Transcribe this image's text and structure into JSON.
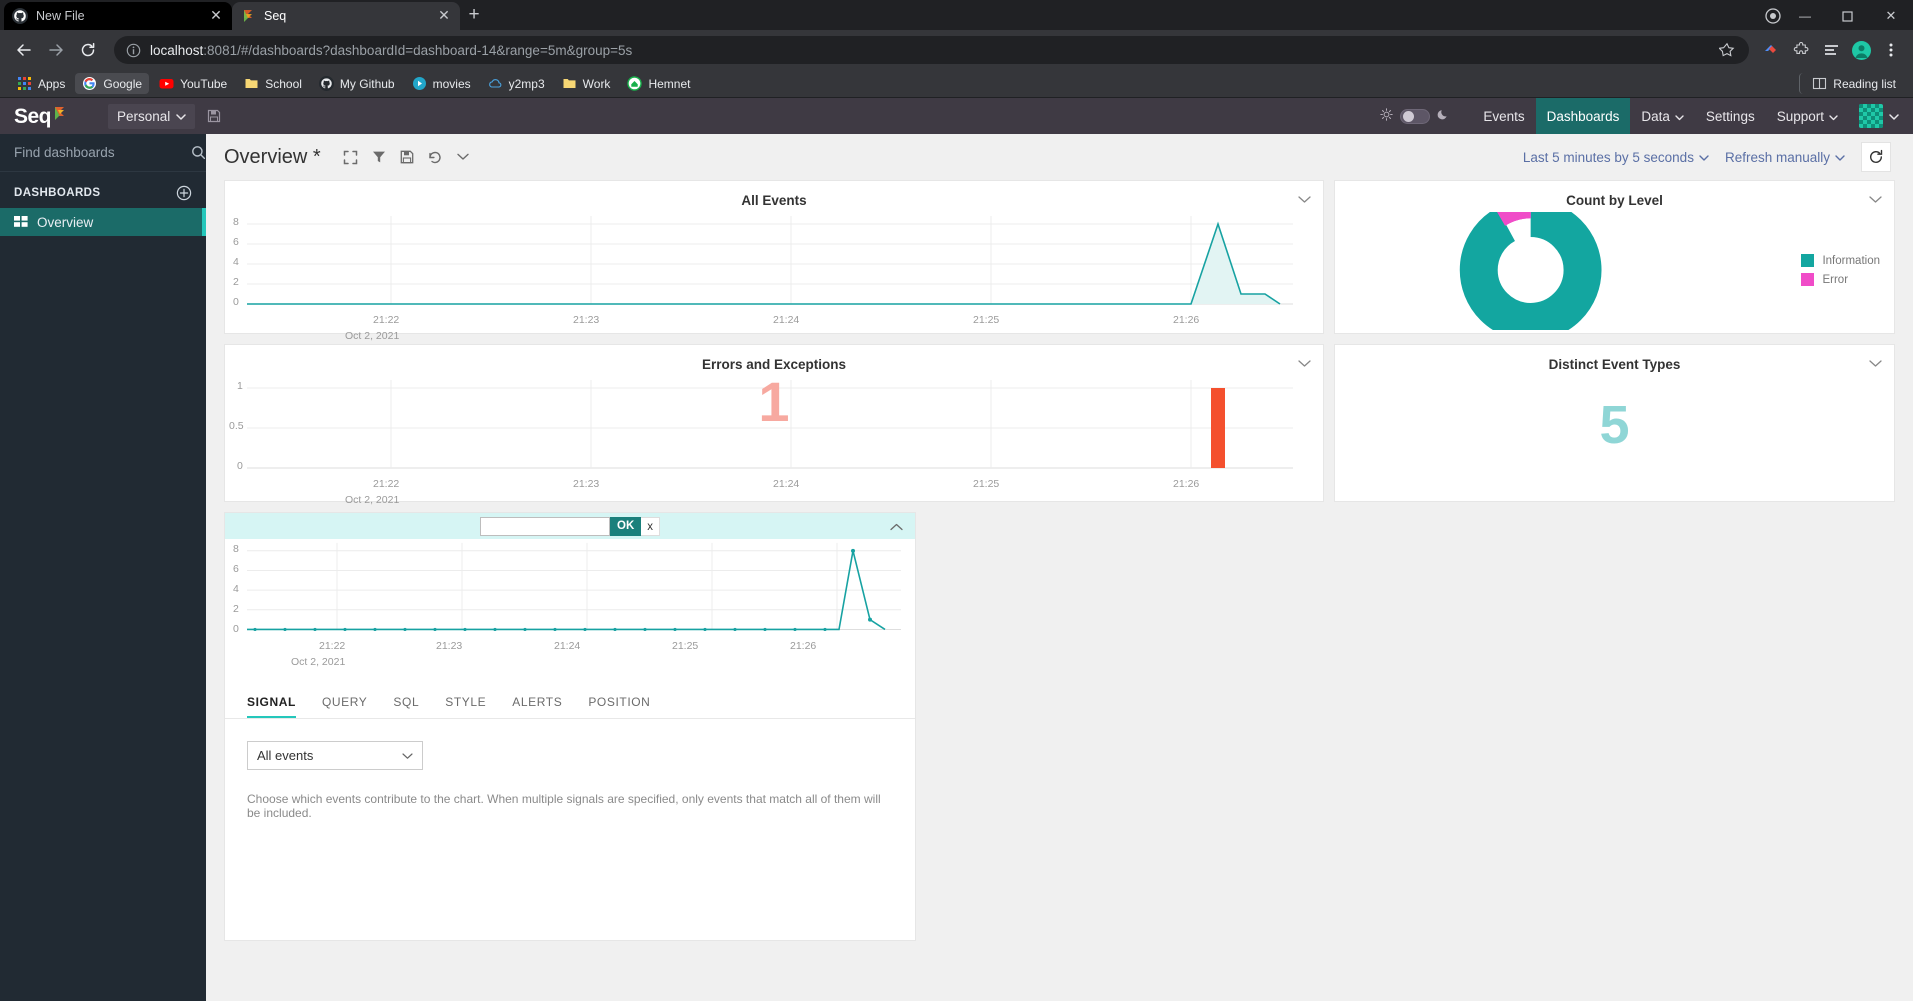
{
  "browser": {
    "tabs": [
      {
        "title": "New File",
        "favicon": "github-icon",
        "active": false
      },
      {
        "title": "Seq",
        "favicon": "seq-icon",
        "active": true
      }
    ],
    "new_tab_label": "+",
    "close_label": "✕",
    "url": {
      "host": "localhost",
      "rest": ":8081/#/dashboards?dashboardId=dashboard-14&range=5m&group=5s"
    },
    "bookmarks": [
      {
        "label": "Apps",
        "icon": "apps-grid-icon"
      },
      {
        "label": "Google",
        "icon": "google-icon"
      },
      {
        "label": "YouTube",
        "icon": "youtube-icon"
      },
      {
        "label": "School",
        "icon": "folder-icon"
      },
      {
        "label": "My Github",
        "icon": "github-icon"
      },
      {
        "label": "movies",
        "icon": "play-circle-icon"
      },
      {
        "label": "y2mp3",
        "icon": "cloud-icon"
      },
      {
        "label": "Work",
        "icon": "folder-icon"
      },
      {
        "label": "Hemnet",
        "icon": "hemnet-icon"
      }
    ],
    "reading_list": "Reading list",
    "window_controls": {
      "minimize": "—",
      "maximize": "❐",
      "close": "✕"
    }
  },
  "app": {
    "brand": "Seq",
    "org": "Personal",
    "nav": [
      {
        "label": "Events",
        "active": false,
        "caret": false
      },
      {
        "label": "Dashboards",
        "active": true,
        "caret": false
      },
      {
        "label": "Data",
        "active": false,
        "caret": true
      },
      {
        "label": "Settings",
        "active": false,
        "caret": false
      },
      {
        "label": "Support",
        "active": false,
        "caret": true
      }
    ],
    "accent": "#1b6b68",
    "teal": "#17a2a2"
  },
  "sidebar": {
    "search_placeholder": "Find dashboards",
    "section_title": "DASHBOARDS",
    "add_label": "+",
    "items": [
      {
        "label": "Overview",
        "active": true
      }
    ]
  },
  "header": {
    "title": "Overview *",
    "icons": [
      "fullscreen-icon",
      "filter-icon",
      "save-icon",
      "undo-icon",
      "chevron-down-icon"
    ],
    "range_label": "Last 5 minutes by 5 seconds",
    "refresh_mode_label": "Refresh manually",
    "refresh_icon": "refresh-icon"
  },
  "cards": {
    "all_events": {
      "title": "All Events"
    },
    "count_by_level": {
      "title": "Count by Level",
      "legend": [
        {
          "label": "Information",
          "color": "#13a6a0"
        },
        {
          "label": "Error",
          "color": "#f04cc8"
        }
      ]
    },
    "errors": {
      "title": "Errors and Exceptions",
      "ghost_value": "1"
    },
    "distinct": {
      "title": "Distinct Event Types",
      "value": "5"
    }
  },
  "editor": {
    "title_value": "",
    "ok_label": "OK",
    "cancel_label": "x",
    "collapse_icon": "chevron-up-icon",
    "tabs": [
      {
        "label": "SIGNAL",
        "active": true
      },
      {
        "label": "QUERY",
        "active": false
      },
      {
        "label": "SQL",
        "active": false
      },
      {
        "label": "STYLE",
        "active": false
      },
      {
        "label": "ALERTS",
        "active": false
      },
      {
        "label": "POSITION",
        "active": false
      }
    ],
    "signal_select": "All events",
    "help_text": "Choose which events contribute to the chart. When multiple signals are specified, only events that match all of them will be included."
  },
  "chart_data": [
    {
      "id": "all-events",
      "type": "line",
      "title": "All Events",
      "xlabel": "",
      "ylabel": "",
      "date_label": "Oct 2, 2021",
      "xticks": [
        "21:22",
        "21:23",
        "21:24",
        "21:25",
        "21:26"
      ],
      "yticks": [
        0,
        2,
        4,
        6,
        8
      ],
      "ylim": [
        0,
        8.6
      ],
      "grid": true,
      "legend": "none",
      "series": [
        {
          "name": "count",
          "color": "#17a2a2",
          "fill": "#e2f4f3",
          "x": [
            0,
            0.08,
            0.16,
            0.24,
            0.32,
            0.4,
            0.48,
            0.56,
            0.64,
            0.72,
            0.8,
            0.88,
            0.925,
            0.945,
            0.962,
            0.978,
            1.0
          ],
          "values": [
            0,
            0,
            0,
            0,
            0,
            0,
            0,
            0,
            0,
            0,
            0,
            0,
            0,
            8,
            1,
            1,
            0
          ]
        }
      ]
    },
    {
      "id": "count-by-level",
      "type": "pie",
      "title": "Count by Level",
      "donut": true,
      "labels": [
        "Information",
        "Error"
      ],
      "values": [
        92,
        8
      ],
      "colors": [
        "#13a6a0",
        "#f04cc8"
      ],
      "legend": "right"
    },
    {
      "id": "errors-and-exceptions",
      "type": "bar",
      "title": "Errors and Exceptions",
      "date_label": "Oct 2, 2021",
      "xticks": [
        "21:22",
        "21:23",
        "21:24",
        "21:25",
        "21:26"
      ],
      "yticks": [
        0,
        0.5,
        1
      ],
      "ylim": [
        0,
        1.08
      ],
      "grid": true,
      "annotation": "1",
      "series": [
        {
          "name": "errors",
          "color": "#f4502e",
          "categories": [
            "21:26:20"
          ],
          "values": [
            1
          ]
        }
      ]
    },
    {
      "id": "distinct-event-types",
      "type": "value",
      "title": "Distinct Event Types",
      "value": 5,
      "color": "#8fd6d6"
    },
    {
      "id": "editor-preview",
      "type": "line",
      "title": "",
      "date_label": "Oct 2, 2021",
      "xticks": [
        "21:22",
        "21:23",
        "21:24",
        "21:25",
        "21:26"
      ],
      "yticks": [
        0,
        2,
        4,
        6,
        8
      ],
      "ylim": [
        0,
        8.6
      ],
      "grid": true,
      "markers": true,
      "series": [
        {
          "name": "count",
          "color": "#17a2a2",
          "x": [
            0,
            0.06,
            0.12,
            0.18,
            0.24,
            0.3,
            0.36,
            0.42,
            0.48,
            0.54,
            0.6,
            0.66,
            0.72,
            0.78,
            0.84,
            0.9,
            0.928,
            0.948,
            0.968,
            1.0
          ],
          "values": [
            0,
            0,
            0,
            0,
            0,
            0,
            0,
            0,
            0,
            0,
            0,
            0,
            0,
            0,
            0,
            0,
            0,
            8,
            1,
            0
          ]
        }
      ]
    }
  ]
}
